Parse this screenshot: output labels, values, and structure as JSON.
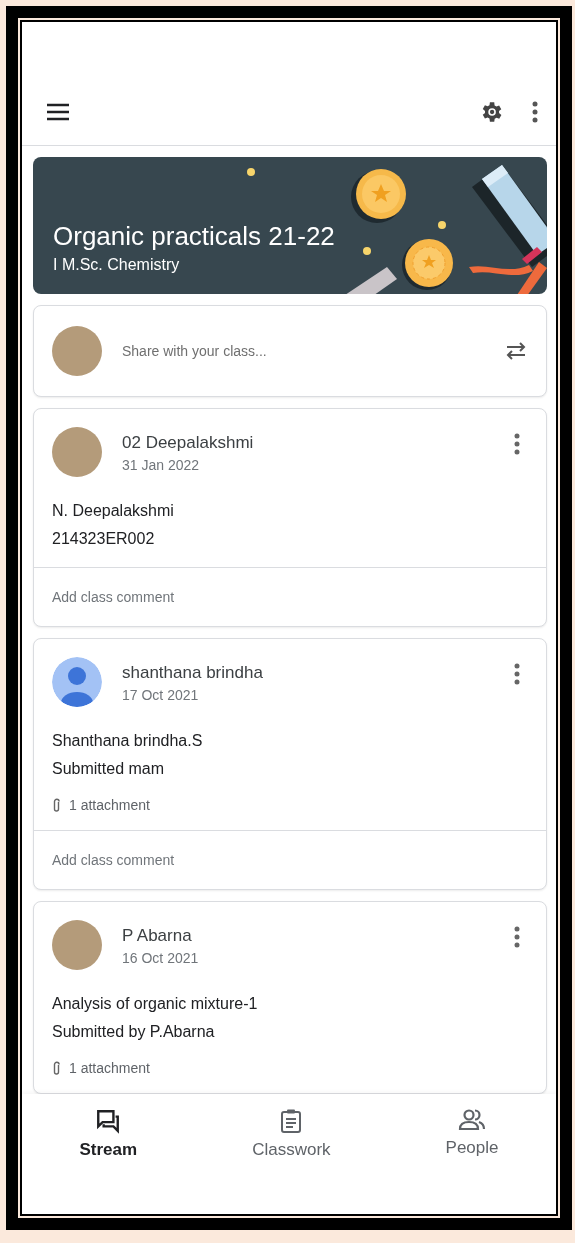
{
  "course": {
    "title": "Organic practicals 21-22",
    "section": "I M.Sc. Chemistry"
  },
  "share": {
    "placeholder": "Share with your class..."
  },
  "posts": [
    {
      "author": "02 Deepalakshmi",
      "date": "31 Jan 2022",
      "avatar": {
        "kind": "photo"
      },
      "lines": [
        "N. Deepalakshmi",
        "214323ER002"
      ],
      "comment_placeholder": "Add class comment"
    },
    {
      "author": "shanthana brindha",
      "date": "17 Oct 2021",
      "avatar": {
        "kind": "default"
      },
      "lines": [
        "Shanthana brindha.S",
        "Submitted mam"
      ],
      "attachment": "1 attachment",
      "comment_placeholder": "Add class comment"
    },
    {
      "author": "P Abarna",
      "date": "16 Oct 2021",
      "avatar": {
        "kind": "photo"
      },
      "lines": [
        "Analysis of organic mixture-1",
        "Submitted by P.Abarna"
      ],
      "attachment": "1 attachment"
    }
  ],
  "nav": [
    {
      "label": "Stream",
      "selected": true
    },
    {
      "label": "Classwork",
      "selected": false
    },
    {
      "label": "People",
      "selected": false
    }
  ]
}
